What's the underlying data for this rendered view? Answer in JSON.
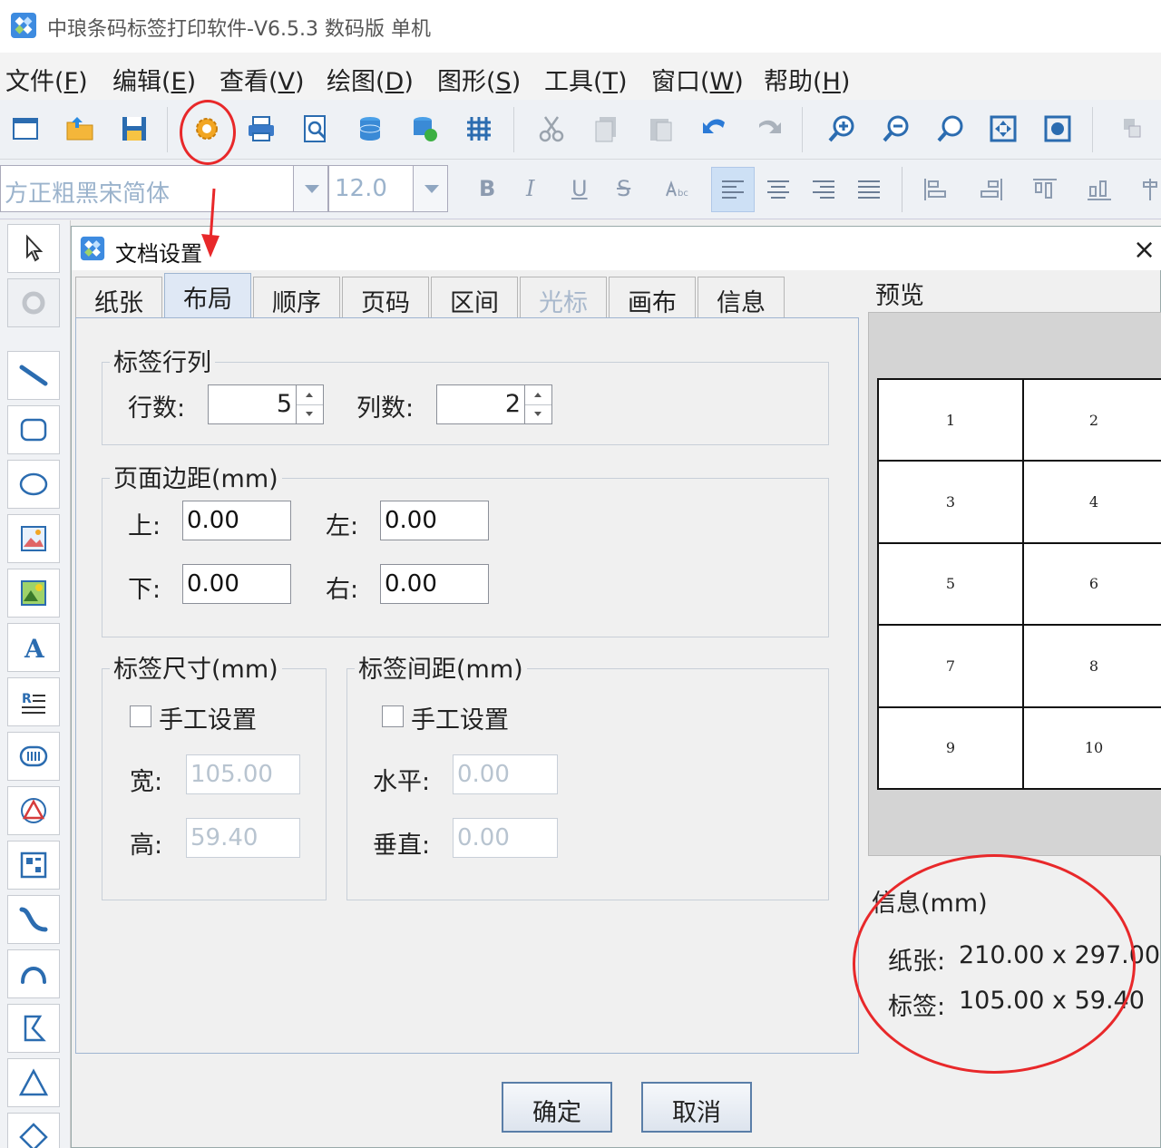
{
  "window": {
    "title": "中琅条码标签打印软件-V6.5.3 数码版 单机"
  },
  "menu": [
    {
      "label": "文件(",
      "key": "F",
      "tail": ")"
    },
    {
      "label": "编辑(",
      "key": "E",
      "tail": ")"
    },
    {
      "label": "查看(",
      "key": "V",
      "tail": ")"
    },
    {
      "label": "绘图(",
      "key": "D",
      "tail": ")"
    },
    {
      "label": "图形(",
      "key": "S",
      "tail": ")"
    },
    {
      "label": "工具(",
      "key": "T",
      "tail": ")"
    },
    {
      "label": "窗口(",
      "key": "W",
      "tail": ")"
    },
    {
      "label": "帮助(",
      "key": "H",
      "tail": ")"
    }
  ],
  "fontbar": {
    "font_name": "方正粗黑宋简体",
    "font_size": "12.0",
    "bold": "B",
    "italic": "I",
    "underline": "U",
    "strike": "S"
  },
  "dialog": {
    "title": "文档设置",
    "close": "×",
    "tabs": [
      "纸张",
      "布局",
      "顺序",
      "页码",
      "区间",
      "光标",
      "画布",
      "信息"
    ],
    "layout": {
      "rows_cols": {
        "legend": "标签行列",
        "rows_label": "行数:",
        "rows": "5",
        "cols_label": "列数:",
        "cols": "2"
      },
      "margins": {
        "legend": "页面边距(mm)",
        "top_label": "上:",
        "top": "0.00",
        "left_label": "左:",
        "left": "0.00",
        "bottom_label": "下:",
        "bottom": "0.00",
        "right_label": "右:",
        "right": "0.00"
      },
      "size": {
        "legend": "标签尺寸(mm)",
        "manual": "手工设置",
        "width_label": "宽:",
        "width": "105.00",
        "height_label": "高:",
        "height": "59.40"
      },
      "spacing": {
        "legend": "标签间距(mm)",
        "manual": "手工设置",
        "h_label": "水平:",
        "h": "0.00",
        "v_label": "垂直:",
        "v": "0.00"
      }
    },
    "preview": {
      "legend": "预览",
      "cells": [
        "1",
        "2",
        "3",
        "4",
        "5",
        "6",
        "7",
        "8",
        "9",
        "10"
      ]
    },
    "info": {
      "legend": "信息(mm)",
      "paper_label": "纸张:",
      "paper": "210.00 x 297.00",
      "label_label": "标签:",
      "label": "105.00 x 59.40"
    },
    "ok": "确定",
    "cancel": "取消"
  },
  "colors": {
    "annotation": "#e8282a",
    "accent": "#1e6fc8"
  }
}
